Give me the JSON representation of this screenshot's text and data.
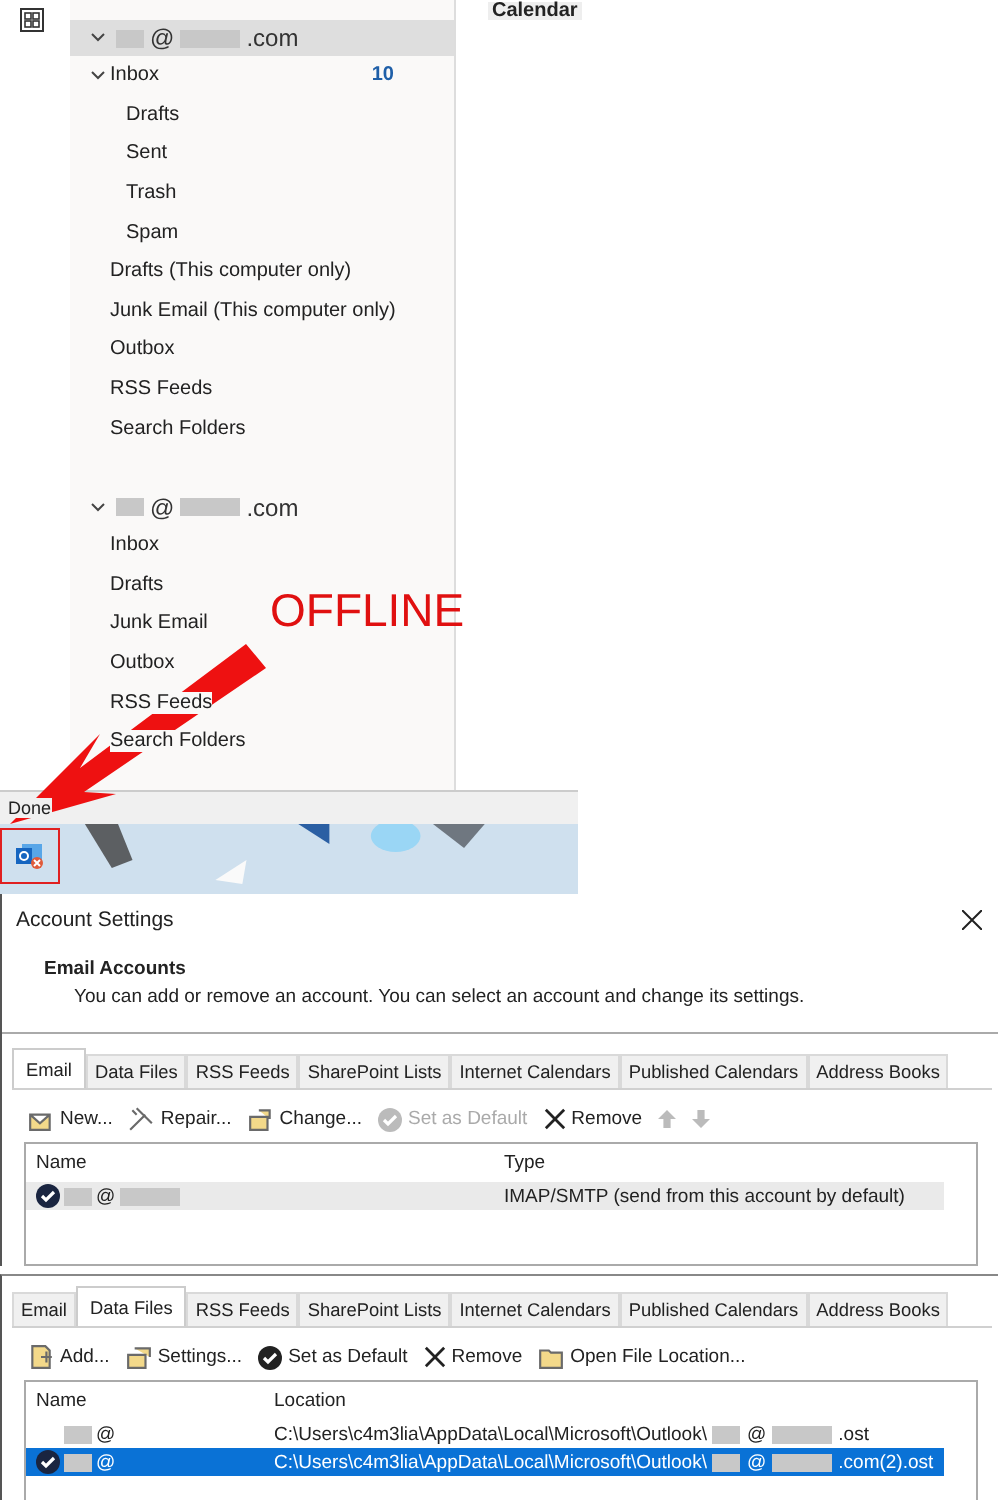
{
  "calendar_label": "Calendar",
  "folder_pane": {
    "accounts": [
      {
        "name_prefix": "@",
        "name_suffix": ".com",
        "selected": true,
        "expanded": true,
        "folders": [
          {
            "label": "Inbox",
            "count": "10",
            "expanded": true,
            "children": [
              {
                "label": "Drafts"
              },
              {
                "label": "Sent"
              },
              {
                "label": "Trash"
              },
              {
                "label": "Spam"
              }
            ]
          },
          {
            "label": "Drafts (This computer only)"
          },
          {
            "label": "Junk Email (This computer only)"
          },
          {
            "label": "Outbox"
          },
          {
            "label": "RSS Feeds"
          },
          {
            "label": "Search Folders"
          }
        ]
      },
      {
        "name_prefix": "@",
        "name_suffix": ".com",
        "selected": false,
        "expanded": true,
        "folders": [
          {
            "label": "Inbox"
          },
          {
            "label": "Drafts"
          },
          {
            "label": "Junk Email"
          },
          {
            "label": "Outbox"
          },
          {
            "label": "RSS Feeds"
          },
          {
            "label": "Search Folders"
          }
        ]
      }
    ]
  },
  "annotation": {
    "text": "OFFLINE"
  },
  "status_bar": {
    "text": "Done"
  },
  "account_settings": {
    "title": "Account Settings",
    "heading": "Email Accounts",
    "description": "You can add or remove an account. You can select an account and change its settings.",
    "tabs": [
      {
        "label": "Email",
        "selected": true
      },
      {
        "label": "Data Files",
        "selected": false
      },
      {
        "label": "RSS Feeds",
        "selected": false
      },
      {
        "label": "SharePoint Lists",
        "selected": false
      },
      {
        "label": "Internet Calendars",
        "selected": false
      },
      {
        "label": "Published Calendars",
        "selected": false
      },
      {
        "label": "Address Books",
        "selected": false
      }
    ],
    "toolbar": [
      {
        "kind": "new",
        "label": "New...",
        "disabled": false
      },
      {
        "kind": "repair",
        "label": "Repair...",
        "disabled": false
      },
      {
        "kind": "change",
        "label": "Change...",
        "disabled": false
      },
      {
        "kind": "default",
        "label": "Set as Default",
        "disabled": true
      },
      {
        "kind": "remove",
        "label": "Remove",
        "disabled": false
      },
      {
        "kind": "up",
        "disabled": true
      },
      {
        "kind": "down",
        "disabled": true
      }
    ],
    "columns": [
      "Name",
      "Type"
    ],
    "rows": [
      {
        "name": "@",
        "type": "IMAP/SMTP (send from this account by default)",
        "default": true,
        "selected": true
      }
    ]
  },
  "data_files": {
    "tabs": [
      {
        "label": "Email",
        "selected": false
      },
      {
        "label": "Data Files",
        "selected": true
      },
      {
        "label": "RSS Feeds",
        "selected": false
      },
      {
        "label": "SharePoint Lists",
        "selected": false
      },
      {
        "label": "Internet Calendars",
        "selected": false
      },
      {
        "label": "Published Calendars",
        "selected": false
      },
      {
        "label": "Address Books",
        "selected": false
      }
    ],
    "toolbar": [
      {
        "kind": "add",
        "label": "Add...",
        "disabled": false
      },
      {
        "kind": "settings",
        "label": "Settings...",
        "disabled": false
      },
      {
        "kind": "default",
        "label": "Set as Default",
        "disabled": false
      },
      {
        "kind": "remove",
        "label": "Remove",
        "disabled": false
      },
      {
        "kind": "folder",
        "label": "Open File Location...",
        "disabled": false
      }
    ],
    "columns": [
      "Name",
      "Location"
    ],
    "rows": [
      {
        "name": "@",
        "location": "C:\\Users\\c4m3lia\\AppData\\Local\\Microsoft\\Outlook\\",
        "file_name": "@",
        "file_suffix": ".ost",
        "default": false,
        "selected": false
      },
      {
        "name": "@",
        "location": "C:\\Users\\c4m3lia\\AppData\\Local\\Microsoft\\Outlook\\",
        "file_name": "@",
        "file_suffix": ".com(2).ost",
        "default": true,
        "selected": true
      }
    ]
  }
}
